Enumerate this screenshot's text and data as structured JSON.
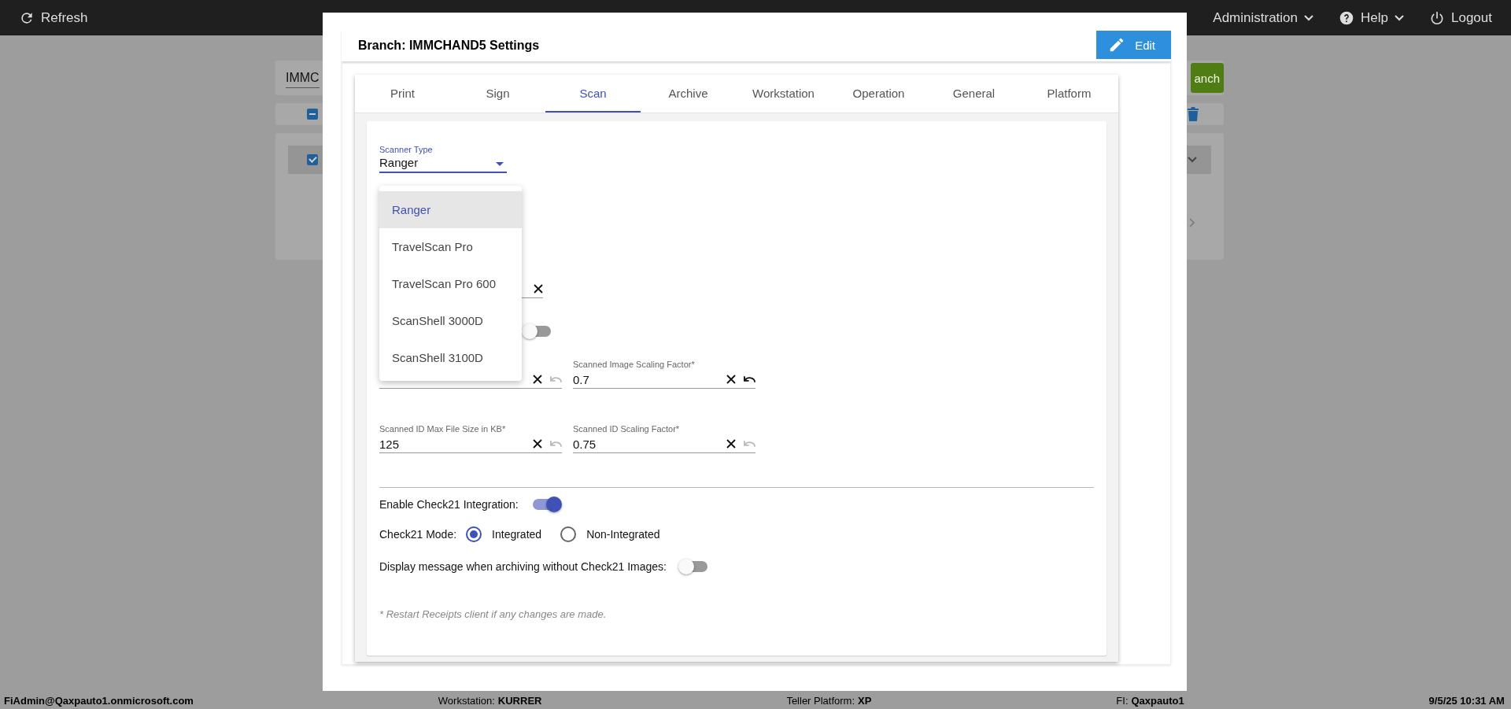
{
  "top_bar": {
    "refresh": "Refresh",
    "menus": [
      {
        "label": "Administration"
      },
      {
        "label": "Help"
      }
    ],
    "logout": "Logout"
  },
  "background": {
    "search_value": "IMMC",
    "button": "anch",
    "header_checkbox": {
      "indeterminate": true
    },
    "row_checkbox": {
      "checked": true
    }
  },
  "dialog": {
    "title": "Branch: IMMCHAND5 Settings",
    "edit_button": "Edit",
    "tabs": [
      {
        "label": "Print",
        "selected": false
      },
      {
        "label": "Sign",
        "selected": false
      },
      {
        "label": "Scan",
        "selected": true
      },
      {
        "label": "Archive",
        "selected": false
      },
      {
        "label": "Workstation",
        "selected": false
      },
      {
        "label": "Operation",
        "selected": false
      },
      {
        "label": "General",
        "selected": false
      },
      {
        "label": "Platform",
        "selected": false
      }
    ],
    "scanner_type": {
      "label": "Scanner Type",
      "value": "Ranger",
      "expanded": true
    },
    "menu": [
      {
        "label": "Ranger",
        "selected": true
      },
      {
        "label": "TravelScan Pro",
        "selected": false
      },
      {
        "label": "TravelScan Pro 600",
        "selected": false
      },
      {
        "label": "ScanShell 3000D",
        "selected": false
      },
      {
        "label": "ScanShell 3100D",
        "selected": false
      }
    ],
    "rows": [
      {
        "kind": "spacer"
      },
      {
        "kind": "covered-field"
      },
      {
        "kind": "covered-toggle",
        "on": false
      },
      {
        "kind": "pair",
        "fields": [
          {
            "kind": "covered",
            "undo_enabled": false
          },
          {
            "kind": "text",
            "label": "Scanned Image Scaling Factor*",
            "value": "0.7",
            "undo_enabled": true
          }
        ]
      },
      {
        "kind": "pair",
        "fields": [
          {
            "kind": "text",
            "label": "Scanned ID Max File Size in KB*",
            "value": "125",
            "undo_enabled": false
          },
          {
            "kind": "text",
            "label": "Scanned ID Scaling Factor*",
            "value": "0.75",
            "undo_enabled": false
          }
        ]
      }
    ],
    "check21": {
      "label": "Enable Check21 Integration:",
      "on": true
    },
    "mode": {
      "label": "Check21 Mode:",
      "options": [
        {
          "label": "Integrated",
          "selected": true
        },
        {
          "label": "Non-Integrated",
          "selected": false
        }
      ]
    },
    "display_message": {
      "label": "Display message when archiving without Check21 Images:",
      "on": false
    },
    "note": "* Restart Receipts client if any changes are made."
  },
  "status_bar": {
    "user": "FiAdmin@Qaxpauto1.onmicrosoft.com",
    "items": [
      {
        "label": "Workstation:",
        "value": "KURRER"
      },
      {
        "label": "Teller Platform:",
        "value": "XP"
      },
      {
        "label": "FI:",
        "value": "Qaxpauto1"
      }
    ],
    "datetime": "9/5/25 10:31 AM"
  }
}
